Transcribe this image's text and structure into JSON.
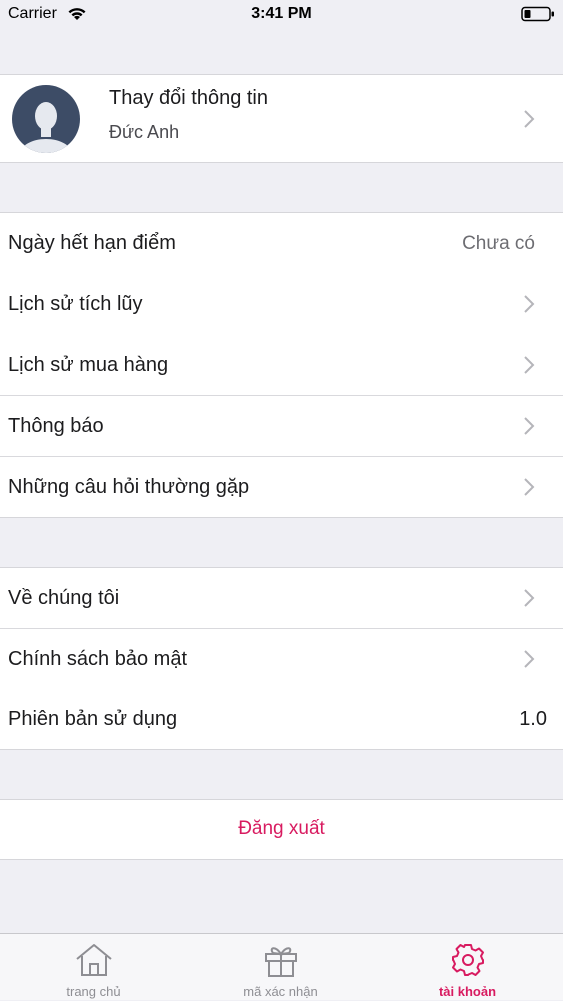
{
  "status_bar": {
    "carrier": "Carrier",
    "time": "3:41 PM",
    "wifi_icon": "wifi-icon",
    "battery_icon": "battery-icon"
  },
  "profile": {
    "title": "Thay đổi thông tin",
    "name": "Đức Anh",
    "avatar_icon": "avatar-placeholder-icon"
  },
  "menu_section_1": {
    "items": [
      {
        "label": "Ngày hết hạn điểm",
        "value": "Chưa có"
      },
      {
        "label": "Lịch sử tích lũy"
      },
      {
        "label": "Lịch sử mua hàng"
      },
      {
        "label": "Thông báo"
      },
      {
        "label": "Những câu hỏi thường gặp"
      }
    ]
  },
  "menu_section_2": {
    "items": [
      {
        "label": "Về chúng tôi"
      },
      {
        "label": "Chính sách bảo mật"
      },
      {
        "label": "Phiên bản sử dụng",
        "value": "1.0"
      }
    ]
  },
  "logout": {
    "label": "Đăng xuất"
  },
  "tabbar": {
    "tabs": [
      {
        "label": "trang chủ",
        "icon": "home-icon"
      },
      {
        "label": "mã xác nhận",
        "icon": "gift-icon"
      },
      {
        "label": "tài khoản",
        "icon": "gear-icon",
        "active": true
      }
    ]
  },
  "colors": {
    "accent": "#d81b60",
    "background": "#efeff4",
    "secondary_text": "#6d6d72"
  }
}
